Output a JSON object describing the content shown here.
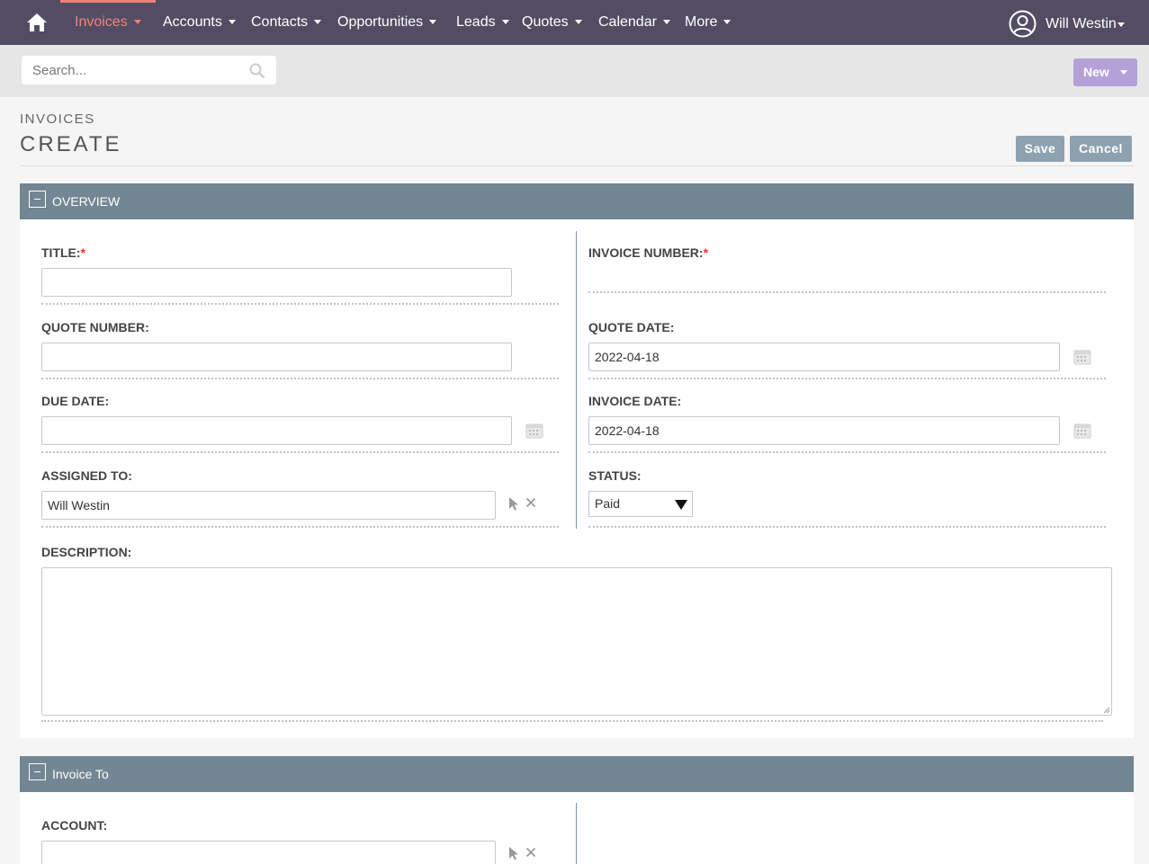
{
  "nav": {
    "items": [
      {
        "label": "Invoices",
        "active": true
      },
      {
        "label": "Accounts"
      },
      {
        "label": "Contacts"
      },
      {
        "label": "Opportunities"
      },
      {
        "label": "Leads"
      },
      {
        "label": "Quotes"
      },
      {
        "label": "Calendar"
      },
      {
        "label": "More"
      }
    ],
    "user_name": "Will Westin"
  },
  "search": {
    "placeholder": "Search..."
  },
  "new_button": "New",
  "header": {
    "module": "INVOICES",
    "title": "CREATE"
  },
  "actions": {
    "save": "Save",
    "cancel": "Cancel"
  },
  "overview": {
    "title": "OVERVIEW",
    "title_label": "TITLE:",
    "title_value": "",
    "invoice_number_label": "INVOICE NUMBER:",
    "quote_number_label": "QUOTE NUMBER:",
    "quote_number_value": "",
    "quote_date_label": "QUOTE DATE:",
    "quote_date_value": "2022-04-18",
    "due_date_label": "DUE DATE:",
    "due_date_value": "",
    "invoice_date_label": "INVOICE DATE:",
    "invoice_date_value": "2022-04-18",
    "assigned_to_label": "ASSIGNED TO:",
    "assigned_to_value": "Will Westin",
    "status_label": "STATUS:",
    "status_value": "Paid",
    "description_label": "DESCRIPTION:",
    "description_value": "",
    "required_mark": "*"
  },
  "invoice_to": {
    "title": "Invoice To",
    "account_label": "ACCOUNT:",
    "account_value": ""
  },
  "colors": {
    "nav_bg": "#534d64",
    "accent": "#f08377",
    "panel_head": "#728693",
    "button": "#8da1b0",
    "new_button": "#b4a1d8"
  }
}
